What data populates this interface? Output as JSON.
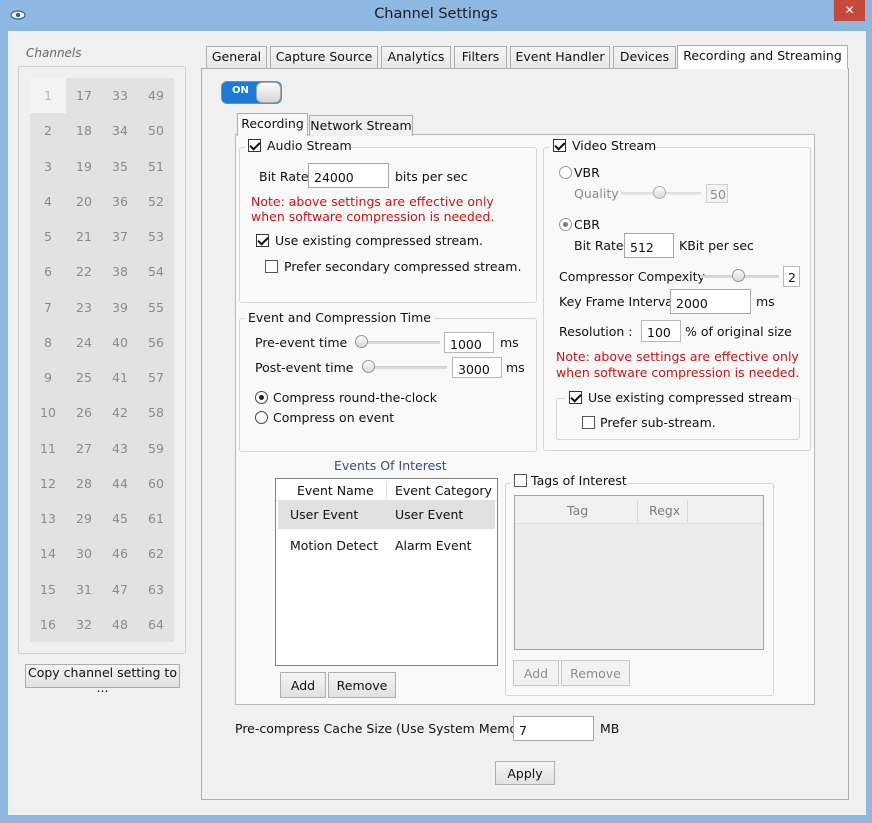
{
  "window": {
    "title": "Channel Settings",
    "close_glyph": "✕"
  },
  "channels": {
    "label": "Channels",
    "columns": [
      [
        "1",
        "2",
        "3",
        "4",
        "5",
        "6",
        "7",
        "8",
        "9",
        "10",
        "11",
        "12",
        "13",
        "14",
        "15",
        "16"
      ],
      [
        "17",
        "18",
        "19",
        "20",
        "21",
        "22",
        "23",
        "24",
        "25",
        "26",
        "27",
        "28",
        "29",
        "30",
        "31",
        "32"
      ],
      [
        "33",
        "34",
        "35",
        "36",
        "37",
        "38",
        "39",
        "40",
        "41",
        "42",
        "43",
        "44",
        "45",
        "46",
        "47",
        "48"
      ],
      [
        "49",
        "50",
        "51",
        "52",
        "53",
        "54",
        "55",
        "56",
        "57",
        "58",
        "59",
        "60",
        "61",
        "62",
        "63",
        "64"
      ]
    ],
    "selected": "1",
    "copy_button": "Copy channel setting to ..."
  },
  "tabs": [
    "General",
    "Capture Source",
    "Analytics",
    "Filters",
    "Event Handler",
    "Devices",
    "Recording and Streaming"
  ],
  "active_tab": "Recording and Streaming",
  "toggle": {
    "label": "ON",
    "state": true
  },
  "inner_tabs": [
    "Recording",
    "Network Stream"
  ],
  "audio": {
    "label": "Audio Stream",
    "checked": true,
    "bitrate_label": "Bit Rate",
    "bitrate_value": "24000",
    "bitrate_unit": "bits per sec",
    "note_line1": "Note: above settings are effective only",
    "note_line2": "when software compression is needed.",
    "use_existing_label": "Use existing compressed stream.",
    "use_existing_checked": true,
    "prefer_secondary_label": "Prefer secondary compressed stream.",
    "prefer_secondary_checked": false
  },
  "event_time": {
    "label": "Event and Compression Time",
    "pre_label": "Pre-event time",
    "pre_value": "1000",
    "post_label": "Post-event time",
    "post_value": "3000",
    "unit": "ms",
    "radio_round": "Compress round-the-clock",
    "radio_event": "Compress on event",
    "selected": "round"
  },
  "video": {
    "label": "Video Stream",
    "checked": true,
    "vbr_label": "VBR",
    "quality_label": "Quality",
    "quality_value": "50",
    "cbr_label": "CBR",
    "mode": "CBR",
    "bitrate_label": "Bit Rate",
    "bitrate_value": "512",
    "bitrate_unit": "KBit per sec",
    "complexity_label": "Compressor Compexity",
    "complexity_value": "2",
    "keyframe_label": "Key Frame Interval",
    "keyframe_value": "2000",
    "keyframe_unit": "ms",
    "resolution_label": "Resolution :",
    "resolution_value": "100",
    "resolution_unit": "% of original size",
    "note_line1": "Note: above settings are effective only",
    "note_line2": "when software compression is needed.",
    "use_existing_label": "Use existing compressed stream",
    "use_existing_checked": true,
    "prefer_sub_label": "Prefer sub-stream.",
    "prefer_sub_checked": false
  },
  "events_of_interest": {
    "title": "Events Of Interest",
    "columns": [
      "Event Name",
      "Event Category"
    ],
    "rows": [
      {
        "name": "User Event",
        "category": "User Event"
      },
      {
        "name": "Motion Detect",
        "category": "Alarm Event"
      }
    ],
    "add": "Add",
    "remove": "Remove"
  },
  "tags_of_interest": {
    "label": "Tags of Interest",
    "checked": false,
    "columns": [
      "Tag",
      "Regx"
    ],
    "add": "Add",
    "remove": "Remove"
  },
  "cache": {
    "label": "Pre-compress Cache Size (Use System Memory)",
    "value": "7",
    "unit": "MB"
  },
  "apply": "Apply"
}
